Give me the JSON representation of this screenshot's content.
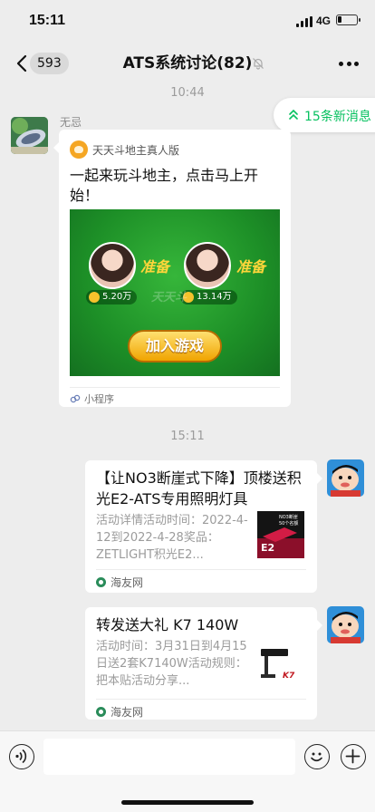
{
  "status_bar": {
    "time": "15:11",
    "network": "4G",
    "battery_level": 0.2
  },
  "nav": {
    "back_count": "593",
    "title": "ATS系统讨论(82)"
  },
  "new_messages": {
    "label": "15条新消息"
  },
  "colors": {
    "accent": "#07c160",
    "background": "#ededed",
    "bubble": "#ffffff",
    "game_green": "#1e8a2a"
  },
  "messages": [
    {
      "timestamp": "10:44",
      "sender": "无忌",
      "mini_program": {
        "app_name": "天天斗地主真人版",
        "title": "一起来玩斗地主，点击马上开始！",
        "left_player": {
          "status": "准备",
          "coins": "5.20万"
        },
        "right_player": {
          "status": "准备",
          "coins": "13.14万"
        },
        "watermark": "天天斗",
        "join_label": "加入游戏",
        "footer": "小程序"
      }
    },
    {
      "timestamp": "15:11",
      "articles": [
        {
          "title": "【让NO3断崖式下降】顶楼送积光E2-ATS专用照明灯具",
          "desc": "活动详情活动时间：2022-4-12到2022-4-28奖品：ZETLIGHT积光E2...",
          "thumb_text_1": "NO3断崖",
          "thumb_text_2": "50个名额",
          "thumb_text_3": "E2",
          "source": "海友网"
        },
        {
          "title": "转发送大礼 K7 140W",
          "desc": "活动时间：3月31日到4月15日送2套K7140W活动规则：把本贴活动分享...",
          "thumb_text_1": "K7",
          "source": "海友网"
        }
      ]
    }
  ],
  "input_bar": {
    "placeholder": ""
  }
}
